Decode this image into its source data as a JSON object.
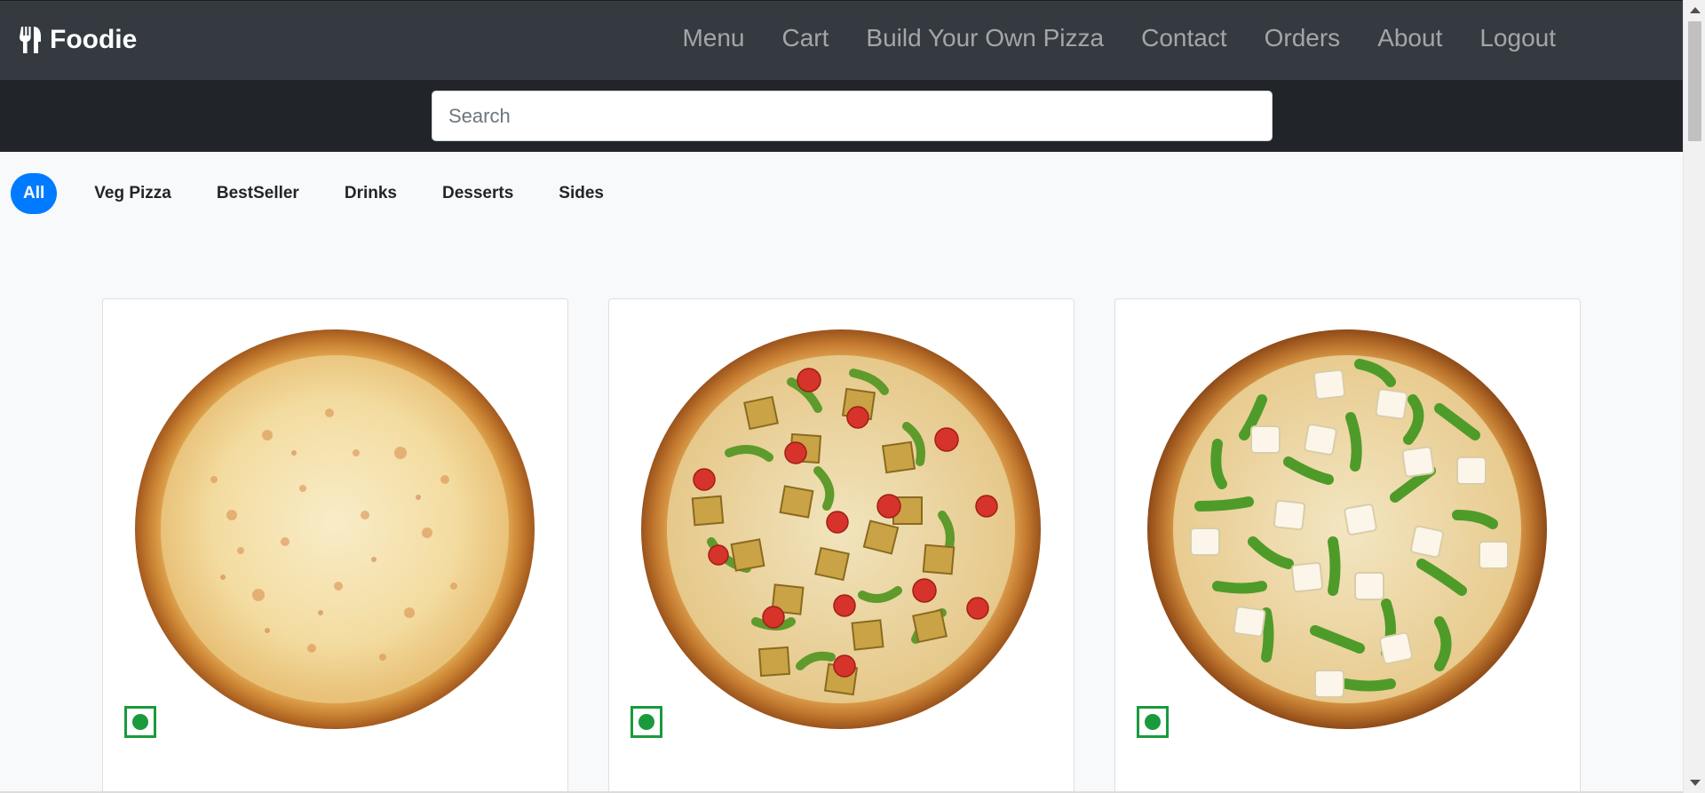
{
  "brand": {
    "name": "Foodie",
    "icon": "utensils-icon"
  },
  "nav": {
    "links": [
      "Menu",
      "Cart",
      "Build Your Own Pizza",
      "Contact",
      "Orders",
      "About",
      "Logout"
    ]
  },
  "search": {
    "placeholder": "Search",
    "value": ""
  },
  "categories": {
    "items": [
      "All",
      "Veg Pizza",
      "BestSeller",
      "Drinks",
      "Desserts",
      "Sides"
    ],
    "selected": "All"
  },
  "products": [
    {
      "type": "margherita-pizza",
      "veg": true
    },
    {
      "type": "paneer-tikka-pizza",
      "veg": true
    },
    {
      "type": "paneer-capsicum-pizza",
      "veg": true
    }
  ],
  "colors": {
    "navbar": "#343a40",
    "search_strip": "#212529",
    "accent": "#007bff",
    "veg_green": "#1a9a3d"
  }
}
